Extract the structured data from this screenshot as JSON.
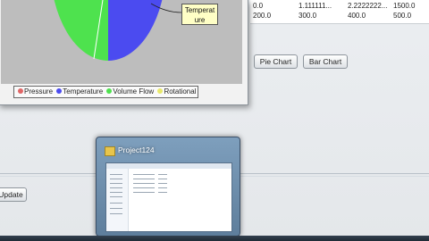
{
  "table": {
    "rows": [
      [
        "0.0",
        "1.111111...",
        "2.2222222...",
        "1500.0"
      ],
      [
        "200.0",
        "300.0",
        "400.0",
        "500.0"
      ]
    ]
  },
  "buttons": {
    "pie_chart": "Pie Chart",
    "bar_chart": "Bar Chart",
    "update": "Update"
  },
  "chart": {
    "tooltip_line1": "Temperat",
    "tooltip_line2": "ure",
    "legend": [
      {
        "label": "Pressure",
        "color": "#e06666"
      },
      {
        "label": "Temperature",
        "color": "#4b4bf0"
      },
      {
        "label": "Volume Flow",
        "color": "#4ee24e"
      },
      {
        "label": "Rotational",
        "color": "#e8e86a"
      }
    ]
  },
  "thumbnail": {
    "title": "Project124"
  }
}
